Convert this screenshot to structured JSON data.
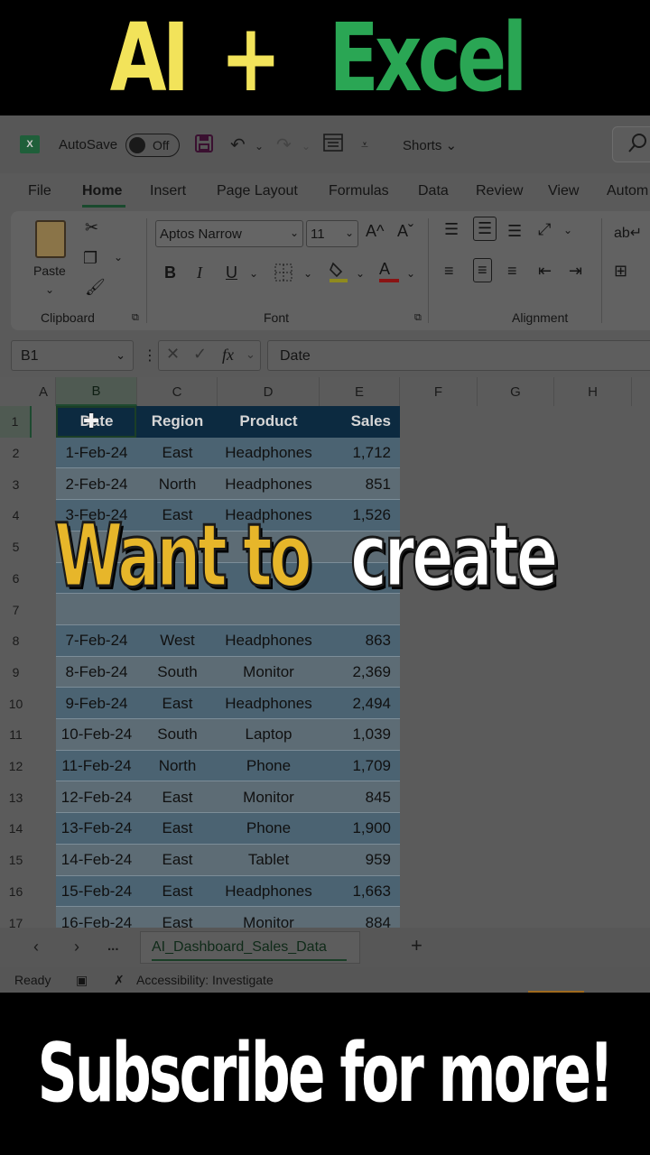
{
  "banner": {
    "word1": "AI",
    "plus": "+",
    "word2": "Excel",
    "color_ai": "#f2e35a",
    "color_excel": "#2aa654"
  },
  "titlebar": {
    "logo": "X",
    "autosave_label": "AutoSave",
    "toggle_state": "Off",
    "doc_name": "Shorts",
    "icons": [
      "excel-logo-icon",
      "save-icon",
      "undo-icon",
      "redo-icon",
      "form-icon",
      "customize-icon",
      "search-icon"
    ]
  },
  "menu": {
    "items": [
      "File",
      "Home",
      "Insert",
      "Page Layout",
      "Formulas",
      "Data",
      "Review",
      "View",
      "Autom"
    ],
    "active": "Home"
  },
  "ribbon": {
    "clipboard": {
      "label": "Clipboard",
      "paste": "Paste"
    },
    "font": {
      "label": "Font",
      "name": "Aptos Narrow",
      "size": "11",
      "bold": "B",
      "italic": "I",
      "underline": "U",
      "grow": "A^",
      "shrink": "Aˇ",
      "fill_icon": "fill-color-icon",
      "font_color": "A"
    },
    "alignment": {
      "label": "Alignment"
    }
  },
  "formula_bar": {
    "name_box": "B1",
    "fx": "fx",
    "value": "Date"
  },
  "grid": {
    "columns": [
      "A",
      "B",
      "C",
      "D",
      "E",
      "F",
      "G",
      "H"
    ],
    "selected_column": "B",
    "rows": [
      "1",
      "2",
      "3",
      "4",
      "5",
      "6",
      "7",
      "8",
      "9",
      "10",
      "11",
      "12",
      "13",
      "14",
      "15",
      "16",
      "17"
    ],
    "headers": [
      "Date",
      "Region",
      "Product",
      "Sales"
    ],
    "data": [
      [
        "1-Feb-24",
        "East",
        "Headphones",
        "1,712"
      ],
      [
        "2-Feb-24",
        "North",
        "Headphones",
        "851"
      ],
      [
        "3-Feb-24",
        "East",
        "Headphones",
        "1,526"
      ],
      [
        "",
        "",
        "",
        ""
      ],
      [
        "",
        "",
        "",
        ""
      ],
      [
        "",
        "",
        "",
        ""
      ],
      [
        "7-Feb-24",
        "West",
        "Headphones",
        "863"
      ],
      [
        "8-Feb-24",
        "South",
        "Monitor",
        "2,369"
      ],
      [
        "9-Feb-24",
        "East",
        "Headphones",
        "2,494"
      ],
      [
        "10-Feb-24",
        "South",
        "Laptop",
        "1,039"
      ],
      [
        "11-Feb-24",
        "North",
        "Phone",
        "1,709"
      ],
      [
        "12-Feb-24",
        "East",
        "Monitor",
        "845"
      ],
      [
        "13-Feb-24",
        "East",
        "Phone",
        "1,900"
      ],
      [
        "14-Feb-24",
        "East",
        "Tablet",
        "959"
      ],
      [
        "15-Feb-24",
        "East",
        "Headphones",
        "1,663"
      ],
      [
        "16-Feb-24",
        "East",
        "Monitor",
        "884"
      ]
    ]
  },
  "sheets": {
    "active": "AI_Dashboard_Sales_Data",
    "nav_more": "..."
  },
  "status": {
    "ready": "Ready",
    "accessibility": "Accessibility: Investigate"
  },
  "caption": {
    "part1": "Want to",
    "part2": "create",
    "color_yellow": "#e7b62a"
  },
  "footer": {
    "text": "Subscribe for more!"
  }
}
